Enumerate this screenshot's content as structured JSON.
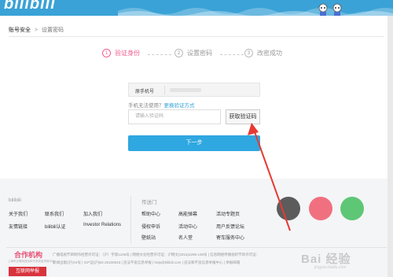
{
  "header": {
    "logo_text": "bilibili",
    "brand_color": "#3aa2d6"
  },
  "breadcrumb": {
    "root": "账号安全",
    "current": "设置密码"
  },
  "steps": [
    {
      "num": "1",
      "label": "验证身份",
      "active": true
    },
    {
      "num": "2",
      "label": "设置密码",
      "active": false
    },
    {
      "num": "3",
      "label": "改密成功",
      "active": false
    }
  ],
  "form": {
    "phone_label": "原手机号",
    "hint_prefix": "手机无法使用？",
    "hint_link": "更换验证方式",
    "code_placeholder": "请输入验证码",
    "code_button": "获取验证码",
    "next_button": "下一步",
    "accent_color": "#2fa7e0"
  },
  "footer": {
    "col1_title": "bilibili",
    "col1_links": [
      "关于我们",
      "联系我们",
      "加入我们",
      "友情链接",
      "bilibili认证",
      "Investor Relations"
    ],
    "col2_title": "传送门",
    "col2_links": [
      "帮助中心",
      "高能弹幕",
      "活动专题页",
      "侵权申诉",
      "活动中心",
      "用户反馈论坛",
      "壁纸站",
      "名人堂",
      "寄车服务中心"
    ],
    "org_title": "合作机构",
    "org_sub": "上海市互联网违法和不良信息举报中心",
    "org_badge": "互联网举报",
    "license_line1": "广播电视节目制作经营许可证：（沪）字第1248号  |  网络文化经营许可证：沪网文(2016)2296-139号  |  信息网络传播视听节目许可证：",
    "license_line2": "新闻出版(沪)XX号 | ICP证(沪)B2-20100043 | 违法不良信息举报 | help@bilibili.com | 违法和不良信息举报中心 | 举报邮箱",
    "watermark": "Bai 经验",
    "watermark_sub": "jingyan.baidu.com"
  }
}
